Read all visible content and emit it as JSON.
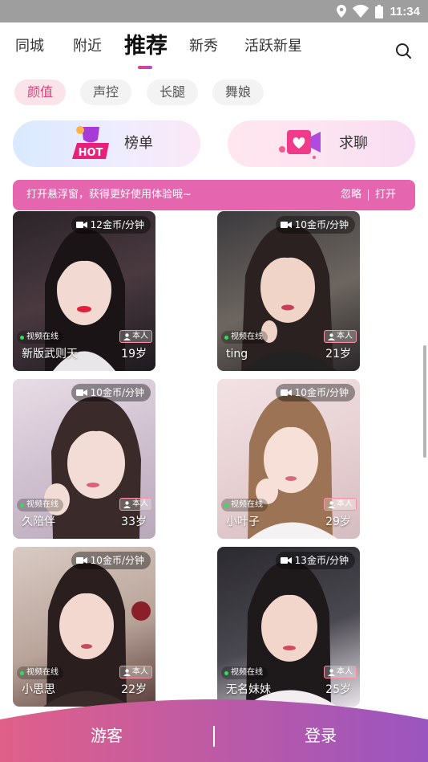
{
  "status_bar": {
    "time": "11:34",
    "icons": [
      "location-icon",
      "wifi-icon",
      "battery-icon"
    ]
  },
  "tabs": [
    {
      "label": "同城"
    },
    {
      "label": "附近"
    },
    {
      "label": "推荐",
      "active": true
    },
    {
      "label": "新秀"
    },
    {
      "label": "活跃新星"
    }
  ],
  "chips": [
    {
      "label": "颜值",
      "active": true
    },
    {
      "label": "声控"
    },
    {
      "label": "长腿"
    },
    {
      "label": "舞娘"
    }
  ],
  "banners": {
    "ranking": {
      "label": "榜单",
      "icon_text": "HOT"
    },
    "chat": {
      "label": "求聊"
    }
  },
  "notice": {
    "text": "打开悬浮窗，获得更好使用体验哦~",
    "ignore": "忽略",
    "open": "打开"
  },
  "card_common": {
    "online_label": "视频在线",
    "badge_label": "本人"
  },
  "cards": [
    {
      "price": "12金币/分钟",
      "name": "新版武则天",
      "age": "19岁"
    },
    {
      "price": "10金币/分钟",
      "name": "ting",
      "age": "21岁"
    },
    {
      "price": "10金币/分钟",
      "name": "久陪伴",
      "age": "33岁"
    },
    {
      "price": "10金币/分钟",
      "name": "小叶子",
      "age": "29岁"
    },
    {
      "price": "10金币/分钟",
      "name": "小思思",
      "age": "22岁"
    },
    {
      "price": "13金币/分钟",
      "name": "无名妹妹",
      "age": "25岁"
    }
  ],
  "bottom_bar": {
    "guest": "游客",
    "login": "登录"
  },
  "colors": {
    "accent": "#d8417a",
    "notice_bg": "#e458a8",
    "bottom_gradient_start": "#e06089",
    "bottom_gradient_end": "#9a55c0"
  }
}
